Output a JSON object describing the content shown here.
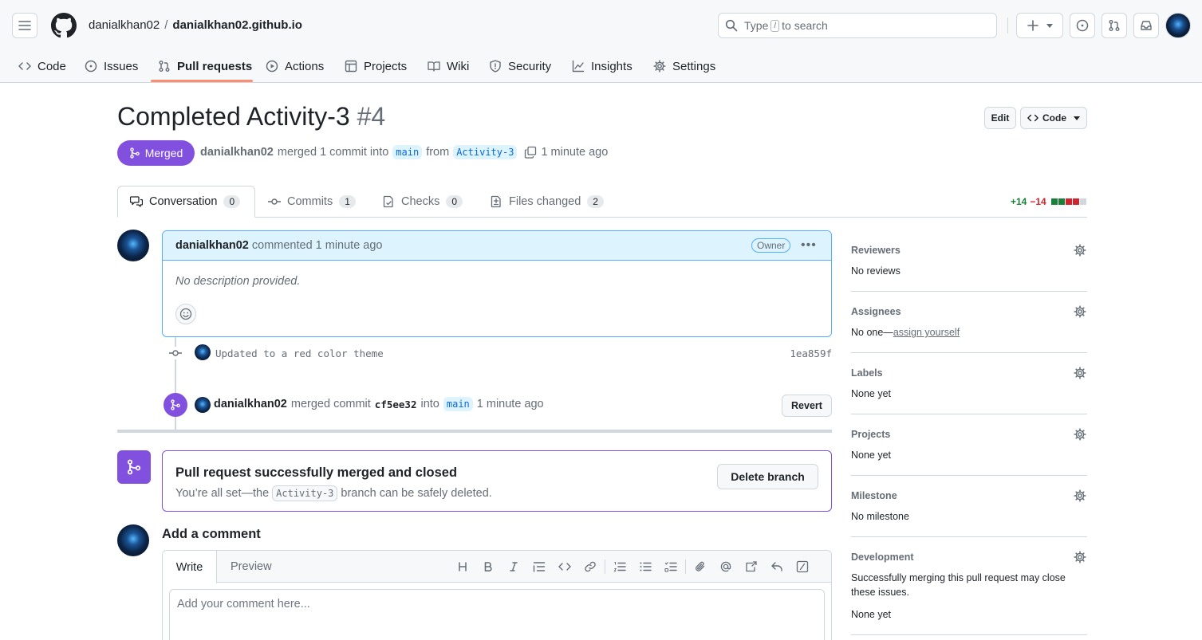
{
  "header": {
    "owner": "danialkhan02",
    "separator": "/",
    "repo": "danialkhan02.github.io",
    "search_prefix": "Type",
    "search_key": "/",
    "search_suffix": "to search"
  },
  "repo_tabs": [
    {
      "label": "Code",
      "icon": "code-icon"
    },
    {
      "label": "Issues",
      "icon": "issue-icon"
    },
    {
      "label": "Pull requests",
      "icon": "pull-request-icon",
      "active": true
    },
    {
      "label": "Actions",
      "icon": "play-icon"
    },
    {
      "label": "Projects",
      "icon": "table-icon"
    },
    {
      "label": "Wiki",
      "icon": "book-icon"
    },
    {
      "label": "Security",
      "icon": "shield-icon"
    },
    {
      "label": "Insights",
      "icon": "graph-icon"
    },
    {
      "label": "Settings",
      "icon": "gear-icon"
    }
  ],
  "pr": {
    "title": "Completed Activity-3",
    "number": "#4",
    "edit_label": "Edit",
    "code_label": "Code",
    "status": "Merged",
    "author": "danialkhan02",
    "action": "merged 1 commit into",
    "base": "main",
    "from": "from",
    "head": "Activity-3",
    "time": "1 minute ago"
  },
  "pr_tabs": [
    {
      "label": "Conversation",
      "count": "0"
    },
    {
      "label": "Commits",
      "count": "1"
    },
    {
      "label": "Checks",
      "count": "0"
    },
    {
      "label": "Files changed",
      "count": "2"
    }
  ],
  "diffstat": {
    "additions": "+14",
    "deletions": "−14"
  },
  "comment": {
    "author": "danialkhan02",
    "action": "commented 1 minute ago",
    "badge": "Owner",
    "body": "No description provided."
  },
  "commit": {
    "message": "Updated to a red color theme",
    "sha": "1ea859f"
  },
  "merge_event": {
    "author": "danialkhan02",
    "action": "merged commit",
    "sha": "cf5ee32",
    "into": "into",
    "base": "main",
    "time": "1 minute ago",
    "revert_label": "Revert"
  },
  "merged_box": {
    "title": "Pull request successfully merged and closed",
    "sub_prefix": "You’re all set—the",
    "branch": "Activity-3",
    "sub_suffix": "branch can be safely deleted.",
    "delete_label": "Delete branch"
  },
  "add_comment": {
    "title": "Add a comment",
    "write_tab": "Write",
    "preview_tab": "Preview",
    "placeholder": "Add your comment here..."
  },
  "sidebar": {
    "reviewers": {
      "title": "Reviewers",
      "value": "No reviews"
    },
    "assignees": {
      "title": "Assignees",
      "value": "No one—",
      "link": "assign yourself"
    },
    "labels": {
      "title": "Labels",
      "value": "None yet"
    },
    "projects": {
      "title": "Projects",
      "value": "None yet"
    },
    "milestone": {
      "title": "Milestone",
      "value": "No milestone"
    },
    "development": {
      "title": "Development",
      "line1": "Successfully merging this pull request may close",
      "line2": "these issues.",
      "value": "None yet"
    }
  },
  "colors": {
    "merged": "#8250df",
    "accent": "#0969da",
    "tab_underline": "#fd8c73",
    "addition": "#1a7f37",
    "deletion": "#d1242f"
  }
}
